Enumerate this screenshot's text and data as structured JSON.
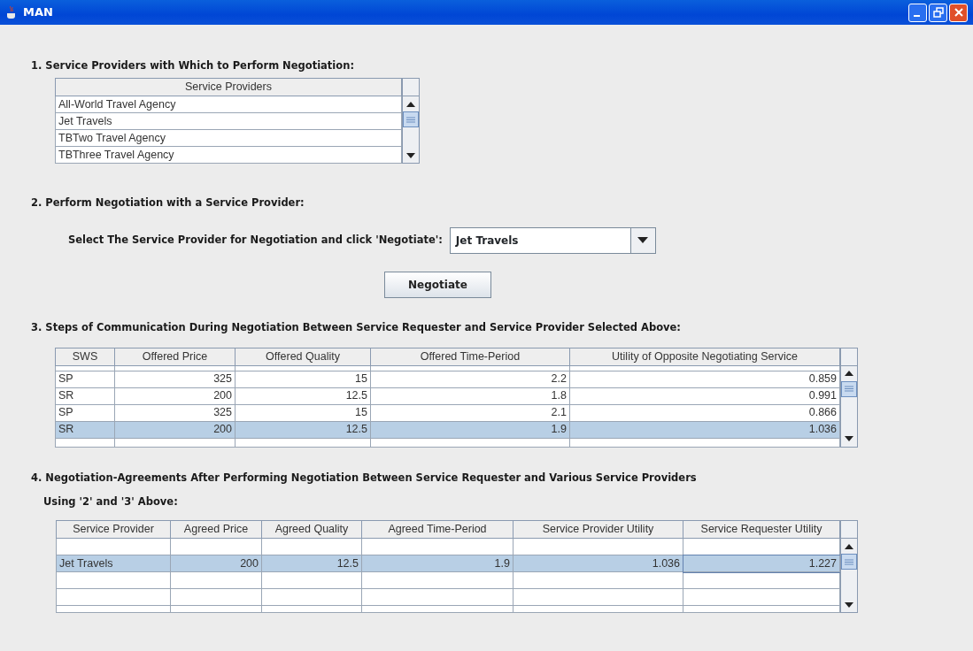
{
  "window": {
    "title": "MAN"
  },
  "step1": {
    "heading": "1. Service Providers with Which to Perform Negotiation:",
    "table": {
      "columns": [
        "Service Providers"
      ],
      "rows": [
        {
          "cells": [
            "All-World Travel Agency"
          ],
          "selected": false
        },
        {
          "cells": [
            "Jet Travels"
          ],
          "selected": false
        },
        {
          "cells": [
            "TBTwo Travel Agency"
          ],
          "selected": false
        },
        {
          "cells": [
            "TBThree Travel Agency"
          ],
          "selected": false
        }
      ]
    }
  },
  "step2": {
    "heading": "2. Perform Negotiation with a Service Provider:",
    "select_label": "Select The Service Provider for Negotiation and click 'Negotiate':",
    "select_value": "Jet Travels",
    "button": "Negotiate"
  },
  "step3": {
    "heading": "3. Steps of Communication During Negotiation Between Service Requester and Service Provider Selected Above:",
    "table": {
      "columns": [
        "SWS",
        "Offered Price",
        "Offered Quality",
        "Offered Time-Period",
        "Utility of Opposite Negotiating Service"
      ],
      "rows": [
        {
          "cells": [
            "SP",
            "325",
            "15",
            "2.2",
            "0.859"
          ],
          "selected": false
        },
        {
          "cells": [
            "SR",
            "200",
            "12.5",
            "1.8",
            "0.991"
          ],
          "selected": false
        },
        {
          "cells": [
            "SP",
            "325",
            "15",
            "2.1",
            "0.866"
          ],
          "selected": false
        },
        {
          "cells": [
            "SR",
            "200",
            "12.5",
            "1.9",
            "1.036"
          ],
          "selected": true
        }
      ]
    }
  },
  "step4": {
    "heading": "4. Negotiation-Agreements After Performing Negotiation Between Service Requester and Various Service Providers",
    "heading_line_2": "Using '2' and '3' Above:",
    "table": {
      "columns": [
        "Service Provider",
        "Agreed Price",
        "Agreed Quality",
        "Agreed Time-Period",
        "Service Provider Utility",
        "Service Requester Utility"
      ],
      "rows": [
        {
          "selected": false
        },
        {
          "cells": [
            "Jet Travels",
            "200",
            "12.5",
            "1.9",
            "1.036",
            "1.227"
          ],
          "selected": true
        },
        {
          "selected": false
        },
        {
          "selected": false
        }
      ]
    }
  }
}
